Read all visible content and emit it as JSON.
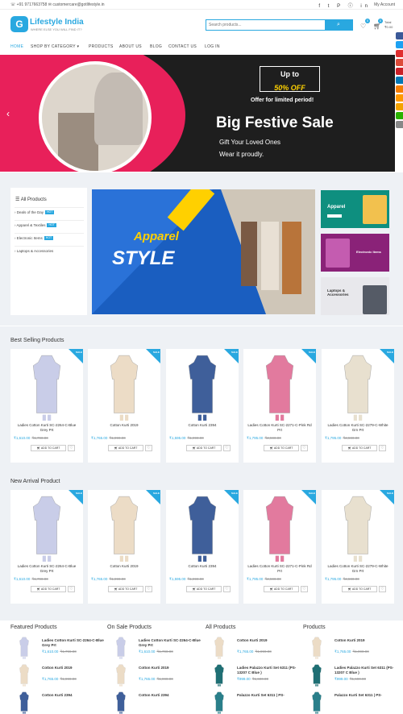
{
  "topbar": {
    "phone": "+91 9717663758",
    "email": "customercare@gotlifestyle.in",
    "social": "f  t  P  ⓘ  in",
    "account": "My Account"
  },
  "brand": {
    "name": "Lifestyle India",
    "tagline": "WHERE ELSE YOU WILL FIND IT?"
  },
  "search": {
    "placeholder": "Search products..."
  },
  "cart": {
    "wishlist_count": "0",
    "cart_count": "0",
    "total_label": "Total",
    "total_value": "₹0.00"
  },
  "nav": [
    "HOME",
    "SHOP BY CATEGORY",
    "PRODUCTS",
    "ABOUT US",
    "BLOG",
    "CONTACT US",
    "LOG IN"
  ],
  "slider": {
    "upto": "Up to",
    "off": "50% OFF",
    "offer": "Offer for limited period!",
    "headline": "Big Festive Sale",
    "line1": "Gift Your Loved Ones",
    "line2": "Wear it proudly."
  },
  "categories": {
    "title": "All Products",
    "items": [
      {
        "label": "Deals of the Day",
        "hot": "HOT"
      },
      {
        "label": "Apparel & Textiles",
        "hot": "HOT"
      },
      {
        "label": "Electronic Items",
        "hot": "HOT"
      },
      {
        "label": "Laptops & Accessories",
        "hot": ""
      }
    ]
  },
  "banners": {
    "big_line1": "Apparel",
    "big_line2": "STYLE",
    "side": [
      "Apparel",
      "Electronic Items",
      "Laptops & Accessories"
    ]
  },
  "best_selling": {
    "title": "Best Selling Products",
    "products": [
      {
        "name": "Ladies Cotton Kurti SC-2264-C-Blue Grey Prt",
        "price": "₹1,610.00",
        "old": "₹1,790.00"
      },
      {
        "name": "Cotton Kurti 2019",
        "price": "₹1,765.00",
        "old": "₹1,990.00"
      },
      {
        "name": "Cotton Kurti 2394",
        "price": "₹1,595.00",
        "old": "₹1,990.00"
      },
      {
        "name": "Ladies Cotton Kurti SC-2271-C-Pink Rd Prt",
        "price": "₹1,795.00",
        "old": "₹2,590.00"
      },
      {
        "name": "Ladies Cotton Kurti SC-2279-C-White Grn Prt",
        "price": "₹1,795.00",
        "old": "₹2,590.00"
      }
    ]
  },
  "new_arrival": {
    "title": "New Arrival Product",
    "products": [
      {
        "name": "Ladies Cotton Kurti SC-2264-C-Blue Grey Prt",
        "price": "₹1,610.00",
        "old": "₹1,790.00"
      },
      {
        "name": "Cotton Kurti 2019",
        "price": "₹1,765.00",
        "old": "₹1,990.00"
      },
      {
        "name": "Cotton Kurti 2394",
        "price": "₹1,595.00",
        "old": "₹1,990.00"
      },
      {
        "name": "Ladies Cotton Kurti SC-2271-C-Pink Rd Prt",
        "price": "₹1,795.00",
        "old": "₹2,590.00"
      },
      {
        "name": "Ladies Cotton Kurti SC-2279-C-White Grn Prt",
        "price": "₹1,795.00",
        "old": "₹2,590.00"
      }
    ]
  },
  "card_labels": {
    "sale": "SALE",
    "add_to_cart": "ADD TO CART"
  },
  "footer_cols": [
    {
      "title": "Featured Products",
      "items": [
        {
          "name": "Ladies Cotton Kurti SC-2264-C-Blue Grey Prt",
          "price": "₹1,610.00",
          "old": "₹1,790.00"
        },
        {
          "name": "Cotton Kurti 2019",
          "price": "₹1,765.00",
          "old": "₹1,990.00"
        },
        {
          "name": "Cotton Kurti 2394",
          "price": "",
          "old": ""
        }
      ]
    },
    {
      "title": "On Sale Products",
      "items": [
        {
          "name": "Ladies Cotton Kurti SC-2264-C-Blue Grey Prt",
          "price": "₹1,610.00",
          "old": "₹1,790.00"
        },
        {
          "name": "Cotton Kurti 2019",
          "price": "₹1,765.00",
          "old": "₹1,990.00"
        },
        {
          "name": "Cotton Kurti 2394",
          "price": "",
          "old": ""
        }
      ]
    },
    {
      "title": "All Products",
      "items": [
        {
          "name": "Cotton Kurti 2019",
          "price": "₹1,765.00",
          "old": "₹1,990.00"
        },
        {
          "name": "Ladies Palazzo Kurti Set 6311 (PS-13207 C Blue )",
          "price": "₹999.00",
          "old": "₹1,690.00"
        },
        {
          "name": "Palazzo Kurti Set 6311 | PS-",
          "price": "",
          "old": ""
        }
      ]
    },
    {
      "title": "Products",
      "items": [
        {
          "name": "Cotton Kurti 2019",
          "price": "₹1,765.00",
          "old": "₹1,990.00"
        },
        {
          "name": "Ladies Palazzo Kurti Set 6311 (PS-13207 C Blue )",
          "price": "₹999.00",
          "old": "₹1,690.00"
        },
        {
          "name": "Palazzo Kurti Set 6311 | PS-",
          "price": "",
          "old": ""
        }
      ]
    }
  ],
  "colors": {
    "accent": "#29a8e0",
    "dark": "#1e1e1e",
    "pink": "#e8205a"
  },
  "product_colors": [
    "#c9cde8",
    "#ecdcc6",
    "#3f5f9a",
    "#e27a9e",
    "#e8e0cf"
  ]
}
